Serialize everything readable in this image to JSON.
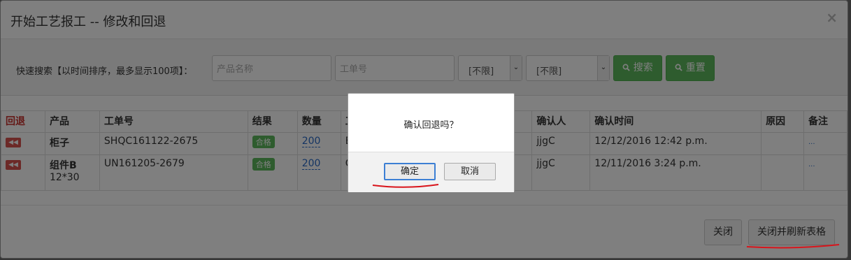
{
  "modal": {
    "title": "开始工艺报工 -- 修改和回退",
    "close_glyph": "×"
  },
  "search": {
    "label": "快速搜索【以时间排序，最多显示100项】：",
    "product_placeholder": "产品名称",
    "order_placeholder": "工单号",
    "select1_value": "[不限]",
    "select2_value": "[不限]",
    "search_button": "搜索",
    "reset_button": "重置"
  },
  "table": {
    "headers": [
      "回退",
      "产品",
      "工单号",
      "结果",
      "数量",
      "工",
      "确认人",
      "确认时间",
      "原因",
      "备注"
    ],
    "rows": [
      {
        "back": "◀◀",
        "product": "柜子",
        "product_sub": "",
        "order": "SHQC161122-2675",
        "result": "合格",
        "qty": "200",
        "col6": "B",
        "confirmer": "jjgC",
        "time": "12/12/2016 12:42 p.m.",
        "reason": "",
        "note": "..."
      },
      {
        "back": "◀◀",
        "product": "组件B",
        "product_sub": "12*30",
        "order": "UN161205-2679",
        "result": "合格",
        "qty": "200",
        "col6": "C",
        "confirmer": "jjgC",
        "time": "12/11/2016 3:24 p.m.",
        "reason": "",
        "note": "..."
      }
    ]
  },
  "footer": {
    "close_button": "关闭",
    "close_refresh_button": "关闭并刷新表格"
  },
  "dialog": {
    "message": "确认回退吗？",
    "ok_button": "确定",
    "cancel_button": "取消"
  },
  "colors": {
    "green": "#5cb85c",
    "red_back": "#d9534f",
    "link_blue": "#2a6bc6",
    "annotation_red": "#d9141b"
  }
}
